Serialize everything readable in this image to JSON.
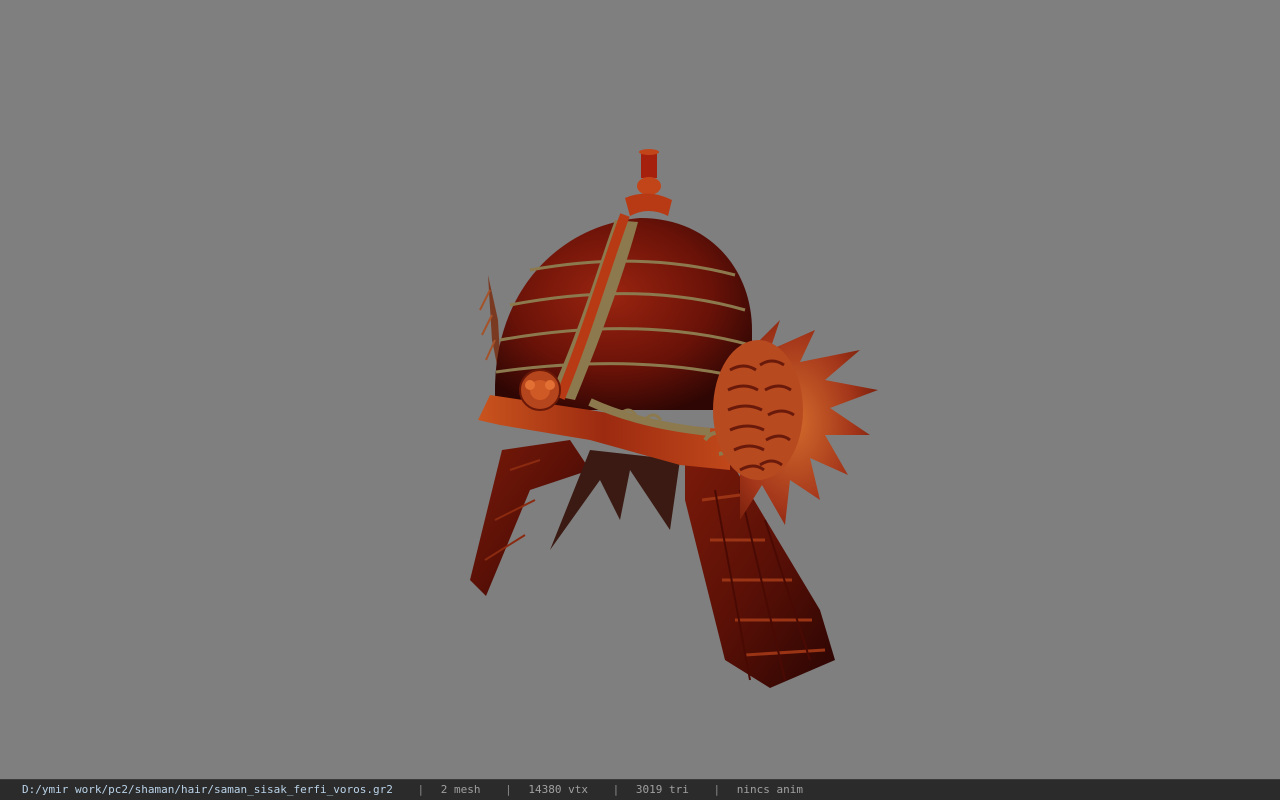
{
  "viewport": {
    "background": "#7f7f7f",
    "model_name": "helmet-3d-model"
  },
  "statusbar": {
    "file_path": "D:/ymir work/pc2/shaman/hair/saman_sisak_ferfi_voros.gr2",
    "separator": "|",
    "mesh_count": "2 mesh",
    "vertex_count": "14380 vtx",
    "triangle_count": "3019 tri",
    "animation": "nincs anim"
  },
  "colors": {
    "helmet_dark": "#4a0d05",
    "helmet_red": "#8e1a0c",
    "helmet_orange": "#c2451a",
    "trim_gold": "#8c7a4e",
    "statusbar_bg": "#2b2b2b",
    "path_text": "#b9d2e8"
  }
}
